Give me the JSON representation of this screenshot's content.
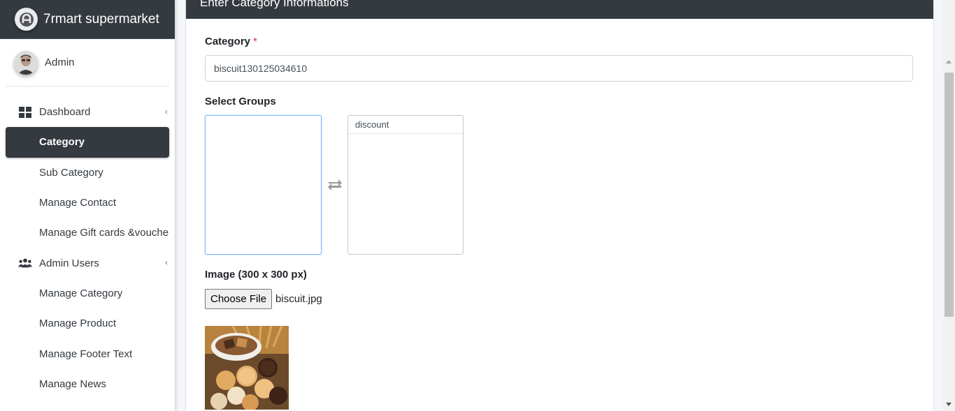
{
  "brand": {
    "name": "7rmart supermarket",
    "logo_icon": "brand-logo-icon"
  },
  "user": {
    "name": "Admin"
  },
  "sidebar": {
    "items": [
      {
        "label": "Dashboard",
        "type": "header",
        "icon": "dashboard-icon"
      },
      {
        "label": "Category",
        "type": "sub",
        "active": true
      },
      {
        "label": "Sub Category",
        "type": "sub"
      },
      {
        "label": "Manage Contact",
        "type": "sub"
      },
      {
        "label": "Manage Gift cards &voucher",
        "type": "sub"
      },
      {
        "label": "Admin Users",
        "type": "header",
        "icon": "users-icon"
      },
      {
        "label": "Manage Category",
        "type": "sub"
      },
      {
        "label": "Manage Product",
        "type": "sub"
      },
      {
        "label": "Manage Footer Text",
        "type": "sub"
      },
      {
        "label": "Manage News",
        "type": "sub"
      }
    ]
  },
  "card": {
    "title": "Enter Category Informations",
    "category_label": "Category",
    "required_mark": "*",
    "category_value": "biscuit130125034610",
    "groups_label": "Select Groups",
    "groups_available": [],
    "groups_selected": [
      "discount"
    ],
    "image_label": "Image (300 x 300 px)",
    "file_button": "Choose File",
    "file_name": "biscuit.jpg"
  },
  "colors": {
    "dark": "#343a40",
    "accent_focus": "#80bdff",
    "required": "#dc3545"
  }
}
